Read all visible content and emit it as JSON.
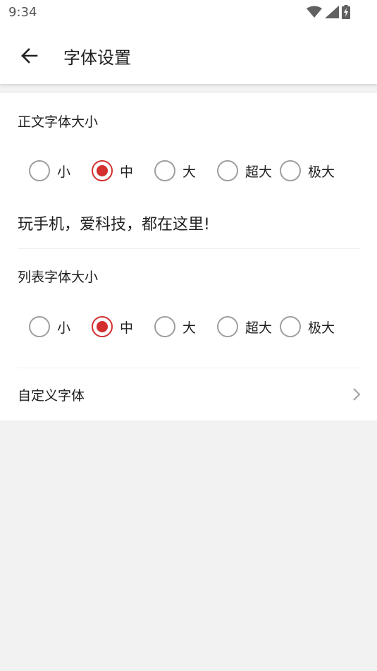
{
  "status_bar": {
    "time": "9:34",
    "icons": [
      "wifi-icon",
      "cellular-signal-icon",
      "battery-charging-icon"
    ]
  },
  "app_bar": {
    "back_icon": "arrow-back-icon",
    "title": "字体设置"
  },
  "body_font": {
    "title": "正文字体大小",
    "options": [
      "小",
      "中",
      "大",
      "超大",
      "极大"
    ],
    "selected": "中"
  },
  "preview": {
    "text": "玩手机，爱科技，都在这里!"
  },
  "list_font": {
    "title": "列表字体大小",
    "options": [
      "小",
      "中",
      "大",
      "超大",
      "极大"
    ],
    "selected": "中"
  },
  "custom_font": {
    "label": "自定义字体",
    "icon": "chevron-right-icon"
  },
  "colors": {
    "accent": "#d32f2f",
    "radio_unchecked": "#9e9e9e",
    "background": "#f2f2f2"
  }
}
